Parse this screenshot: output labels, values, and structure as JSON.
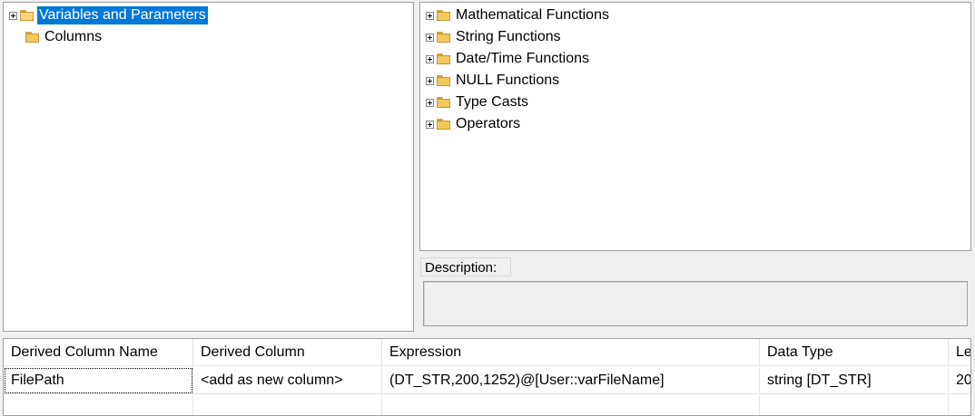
{
  "left_tree": {
    "items": [
      {
        "label": "Variables and Parameters",
        "selected": true,
        "expandable": true,
        "icon": "folder-open-icon"
      },
      {
        "label": "Columns",
        "selected": false,
        "expandable": false,
        "icon": "folder-icon"
      }
    ]
  },
  "right_tree": {
    "items": [
      {
        "label": "Mathematical Functions"
      },
      {
        "label": "String Functions"
      },
      {
        "label": "Date/Time Functions"
      },
      {
        "label": "NULL Functions"
      },
      {
        "label": "Type Casts"
      },
      {
        "label": "Operators"
      }
    ]
  },
  "description": {
    "label": "Description:",
    "text": ""
  },
  "grid": {
    "columns": [
      "Derived Column Name",
      "Derived Column",
      "Expression",
      "Data Type",
      "Le"
    ],
    "rows": [
      [
        "FilePath",
        "<add as new column>",
        "(DT_STR,200,1252)@[User::varFileName]",
        "string [DT_STR]",
        "20"
      ]
    ]
  },
  "colors": {
    "selection": "#0078d7",
    "folder": "#f2c95c"
  }
}
